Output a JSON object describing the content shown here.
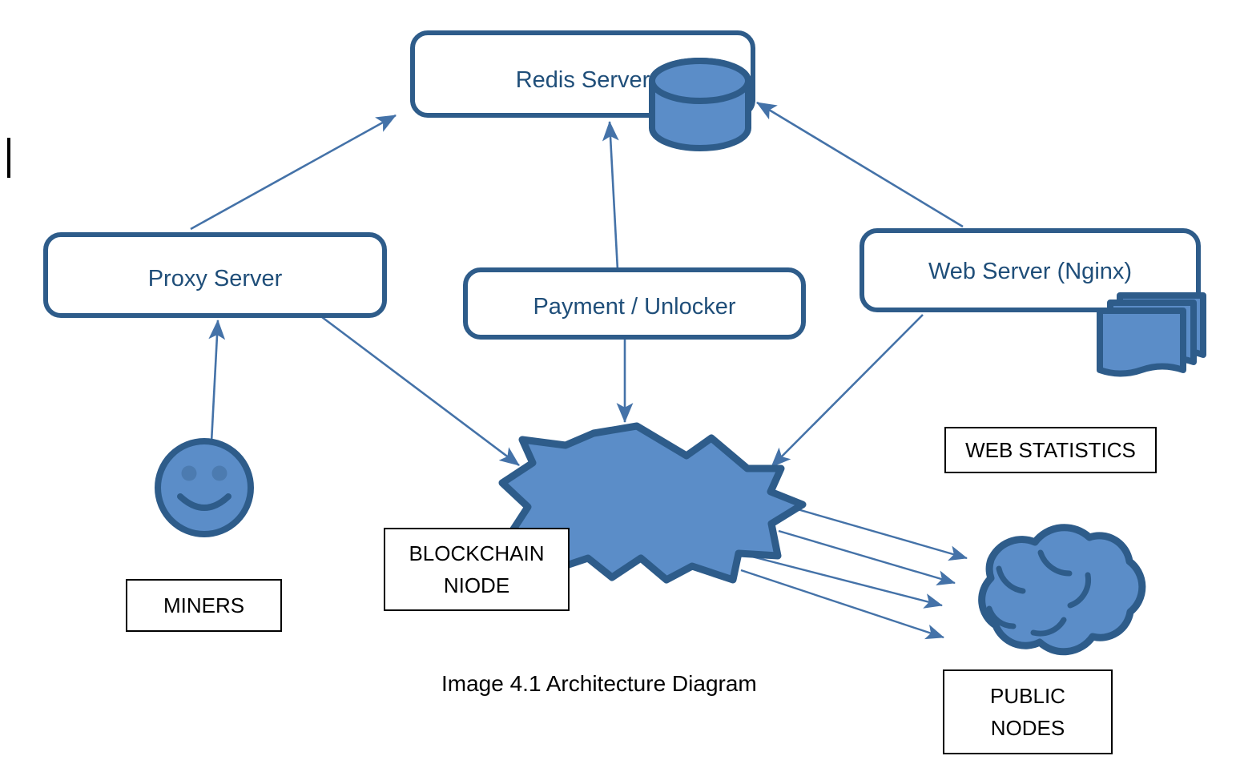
{
  "diagram": {
    "caption": "Image 4.1 Architecture Diagram",
    "colors": {
      "shape_fill": "#5B8DC8",
      "shape_stroke": "#2E5C8A",
      "box_stroke": "#2E5C8A",
      "box_text": "#1F4E79",
      "arrow": "#4472A8",
      "label_box_stroke": "#000000",
      "label_box_text": "#000000",
      "background": "#FFFFFF"
    },
    "nodes": {
      "redis_server": {
        "label": "Redis Server",
        "icon": "database-cylinder-icon"
      },
      "proxy_server": {
        "label": "Proxy Server"
      },
      "payment_unlocker": {
        "label": "Payment / Unlocker"
      },
      "web_server": {
        "label": "Web Server (Nginx)",
        "icon": "document-stack-icon"
      },
      "blockchain_node": {
        "label_line1": "BLOCKCHAIN",
        "label_line2": "NIODE",
        "icon": "explosion-burst-icon"
      },
      "miners": {
        "label": "MINERS",
        "icon": "smiley-face-icon"
      },
      "public_nodes": {
        "label_line1": "PUBLIC",
        "label_line2": "NODES",
        "icon": "cloud-icon"
      },
      "web_statistics": {
        "label": "WEB STATISTICS"
      }
    },
    "connections": [
      {
        "from": "proxy_server",
        "to": "redis_server",
        "direction": "one-way"
      },
      {
        "from": "payment_unlocker",
        "to": "redis_server",
        "direction": "one-way"
      },
      {
        "from": "web_server",
        "to": "redis_server",
        "direction": "one-way"
      },
      {
        "from": "miners",
        "to": "proxy_server",
        "direction": "one-way"
      },
      {
        "from": "proxy_server",
        "to": "blockchain_node",
        "direction": "one-way"
      },
      {
        "from": "payment_unlocker",
        "to": "blockchain_node",
        "direction": "one-way"
      },
      {
        "from": "web_server",
        "to": "blockchain_node",
        "direction": "one-way"
      },
      {
        "from": "blockchain_node",
        "to": "public_nodes",
        "direction": "one-way",
        "count": 4
      }
    ]
  }
}
